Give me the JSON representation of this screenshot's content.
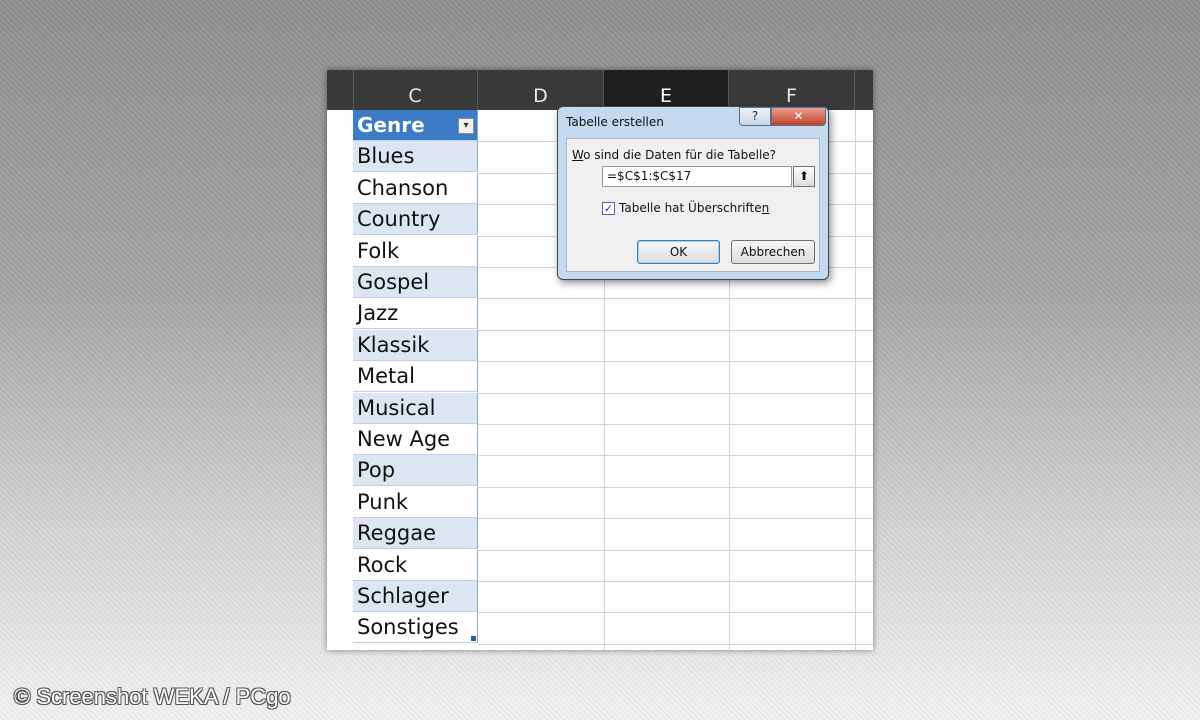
{
  "sheet": {
    "columns": [
      "C",
      "D",
      "E",
      "F"
    ],
    "selected_column": "E",
    "table_header": "Genre",
    "filter_icon": "filter-dropdown-icon",
    "rows": [
      "Blues",
      "Chanson",
      "Country",
      "Folk",
      "Gospel",
      "Jazz",
      "Klassik",
      "Metal",
      "Musical",
      "New Age",
      "Pop",
      "Punk",
      "Reggae",
      "Rock",
      "Schlager",
      "Sonstiges"
    ],
    "colors": {
      "header": "#3c7bc6",
      "band": "#dce6f3",
      "column_header_bg": "#3a3a3a"
    }
  },
  "dialog": {
    "title": "Tabelle erstellen",
    "help_label": "?",
    "close_label": "✕",
    "question_prefix": "W",
    "question_rest": "o sind die Daten für die Tabelle?",
    "range_value": "=$C$1:$C$17",
    "collapse_icon": "⬆",
    "checkbox_checked": true,
    "checkbox_mark": "✓",
    "checkbox_label_main": "Tabelle hat Überschrifte",
    "checkbox_label_accel": "n",
    "ok_label": "OK",
    "cancel_label": "Abbrechen"
  },
  "credit": "© Screenshot WEKA / PCgo"
}
